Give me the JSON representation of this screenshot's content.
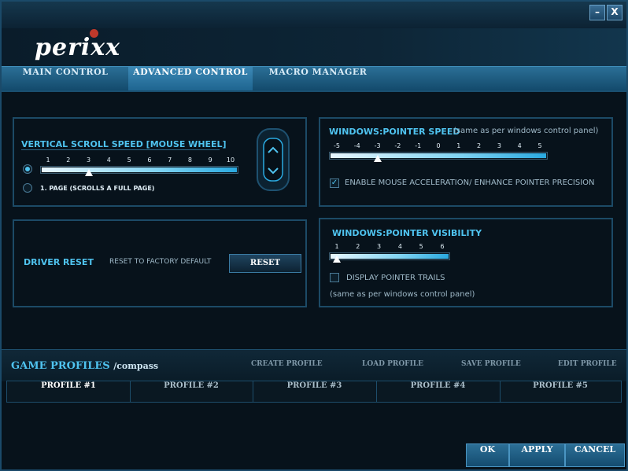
{
  "window": {
    "minimize_label": "–",
    "close_label": "X",
    "logo_text": "perixx",
    "brand_color": "#4fc3ef"
  },
  "tabs": [
    {
      "label": "MAIN CONTROL",
      "active": false
    },
    {
      "label": "ADVANCED CONTROL",
      "active": true
    },
    {
      "label": "MACRO MANAGER",
      "active": false
    }
  ],
  "scroll_speed": {
    "title": "VERTICAL SCROLL SPEED [MOUSE WHEEL]",
    "ticks": [
      "1",
      "2",
      "3",
      "4",
      "5",
      "6",
      "7",
      "8",
      "9",
      "10"
    ],
    "value": 3,
    "page_option_label": "1. PAGE (SCROLLS A FULL PAGE)",
    "selected_option": "lines"
  },
  "pointer_speed": {
    "title": "WINDOWS:POINTER SPEED",
    "note": "(same as per windows control panel)",
    "ticks": [
      "-5",
      "-4",
      "-3",
      "-2",
      "-1",
      "0",
      "1",
      "2",
      "3",
      "4",
      "5"
    ],
    "value": -3,
    "accel_label": "ENABLE MOUSE ACCELERATION/ ENHANCE POINTER PRECISION",
    "accel_checked": true
  },
  "driver_reset": {
    "title": "DRIVER RESET",
    "description": "RESET TO FACTORY DEFAULT",
    "button_label": "RESET"
  },
  "pointer_visibility": {
    "title": "WINDOWS:POINTER VISIBILITY",
    "ticks": [
      "1",
      "2",
      "3",
      "4",
      "5",
      "6"
    ],
    "value": 1,
    "trails_label": "DISPLAY POINTER TRAILS",
    "trails_checked": false,
    "note": "(same as per windows control panel)"
  },
  "game_profiles": {
    "title": "GAME PROFILES",
    "subtitle": "/compass",
    "actions": [
      "CREATE PROFILE",
      "LOAD PROFILE",
      "SAVE PROFILE",
      "EDIT PROFILE"
    ],
    "profiles": [
      "PROFILE #1",
      "PROFILE #2",
      "PROFILE #3",
      "PROFILE #4",
      "PROFILE #5"
    ],
    "active_profile": 0
  },
  "footer": {
    "ok_label": "OK",
    "apply_label": "APPLY",
    "cancel_label": "CANCEL"
  }
}
